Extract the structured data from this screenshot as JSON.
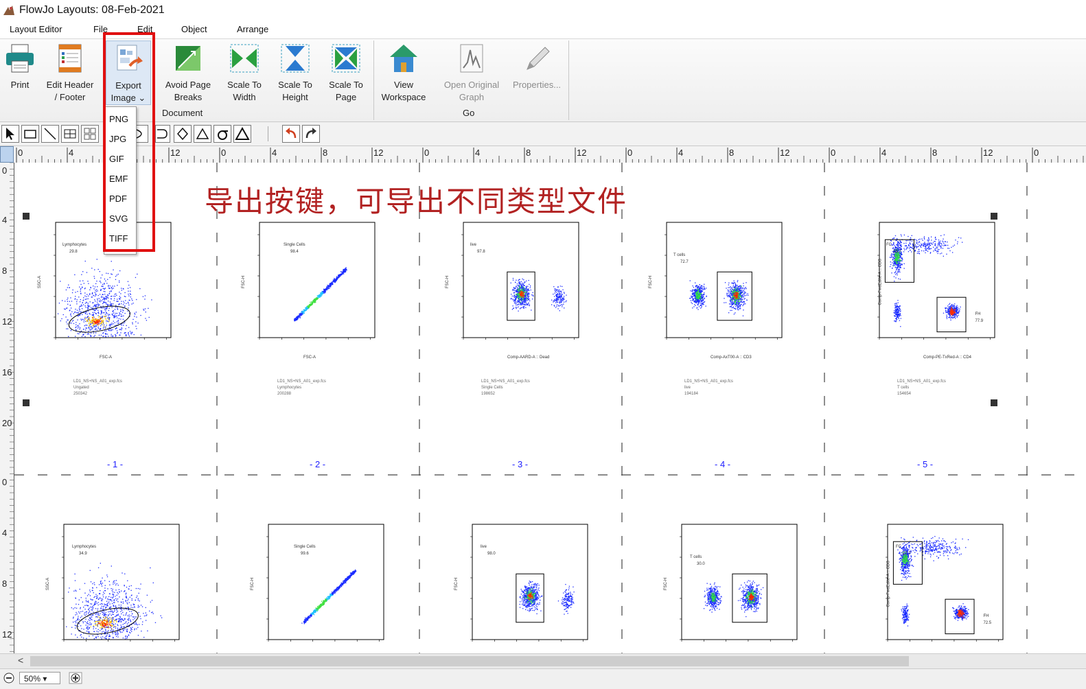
{
  "window": {
    "title": "FlowJo Layouts: 08-Feb-2021"
  },
  "menu": {
    "items": [
      "Layout Editor",
      "File",
      "Edit",
      "Object",
      "Arrange"
    ]
  },
  "ribbon": {
    "buttons": [
      {
        "name": "print",
        "line1": "Print",
        "line2": ""
      },
      {
        "name": "edit-header-footer",
        "line1": "Edit Header",
        "line2": "/ Footer"
      },
      {
        "name": "export-image",
        "line1": "Export",
        "line2": "Image ⌄"
      },
      {
        "name": "avoid-page-breaks",
        "line1": "Avoid Page",
        "line2": "Breaks"
      },
      {
        "name": "scale-to-width",
        "line1": "Scale To",
        "line2": "Width"
      },
      {
        "name": "scale-to-height",
        "line1": "Scale To",
        "line2": "Height"
      },
      {
        "name": "scale-to-page",
        "line1": "Scale To",
        "line2": "Page"
      },
      {
        "name": "view-workspace",
        "line1": "View",
        "line2": "Workspace"
      },
      {
        "name": "open-original-graph",
        "line1": "Open Original",
        "line2": "Graph"
      },
      {
        "name": "properties",
        "line1": "Properties...",
        "line2": ""
      }
    ],
    "groups": {
      "document": "Document",
      "go": "Go"
    }
  },
  "export_menu": {
    "options": [
      "PNG",
      "JPG",
      "GIF",
      "EMF",
      "PDF",
      "SVG",
      "TIFF"
    ]
  },
  "annotation": {
    "text": "导出按键，可导出不同类型文件"
  },
  "rulers": {
    "top_labels": [
      "0",
      "4",
      "8",
      "12",
      "0",
      "4",
      "8",
      "12",
      "0",
      "4",
      "8",
      "12",
      "0",
      "4",
      "8",
      "12",
      "0",
      "4",
      "8",
      "12",
      "0"
    ],
    "left_labels": [
      "0",
      "4",
      "8",
      "12",
      "16",
      "20",
      "0",
      "4",
      "8",
      "12"
    ]
  },
  "pages": [
    "- 1 -",
    "- 2 -",
    "- 3 -",
    "- 4 -",
    "- 5 -"
  ],
  "plots_row1": [
    {
      "ylabel": "SSC-A",
      "xlabel": "FSC-A",
      "gate": "Lymphocytes",
      "pct": "29.8",
      "meta": [
        "LD1_NS+NS_A01_exp.fcs",
        "Ungated",
        "250342"
      ]
    },
    {
      "ylabel": "FSC-H",
      "xlabel": "FSC-A",
      "gate": "Single Cells",
      "pct": "98.4",
      "meta": [
        "LD1_NS+NS_A01_exp.fcs",
        "Lymphocytes",
        "200288"
      ]
    },
    {
      "ylabel": "FSC-H",
      "xlabel": "Comp-AARD-A :: Dead",
      "gate": "live",
      "pct": "97.8",
      "meta": [
        "LD1_NS+NS_A01_exp.fcs",
        "Single Cells",
        "198652"
      ]
    },
    {
      "ylabel": "FSC-H",
      "xlabel": "Comp-AxT00-A :: CD3",
      "gate": "T cells",
      "pct": "72.7",
      "meta": [
        "LD1_NS+NS_A01_exp.fcs",
        "live",
        "194184"
      ]
    },
    {
      "ylabel": "Comp-FwdEdite-A :: CD8",
      "xlabel": "Comp-PE-TxRed-A :: CD4",
      "gate": "FC",
      "pct": "18.7",
      "gate2": "FH",
      "pct2": "77.9",
      "meta": [
        "LD1_NS+NS_A01_exp.fcs",
        "T cells",
        "154654"
      ]
    }
  ],
  "plots_row2": [
    {
      "ylabel": "SSC-A",
      "gate": "Lymphocytes",
      "pct": "34.9"
    },
    {
      "ylabel": "FSC-H",
      "gate": "Single Cells",
      "pct": "99.6"
    },
    {
      "ylabel": "FSC-H",
      "gate": "live",
      "pct": "98.0"
    },
    {
      "ylabel": "FSC-H",
      "gate": "T cells",
      "pct": "30.0"
    },
    {
      "ylabel": "Comp-FwdEdite-A :: CD8",
      "gate": "FC",
      "pct": "17.7",
      "gate2": "FH",
      "pct2": "72.5"
    }
  ],
  "status": {
    "zoom": "50% ▾"
  }
}
